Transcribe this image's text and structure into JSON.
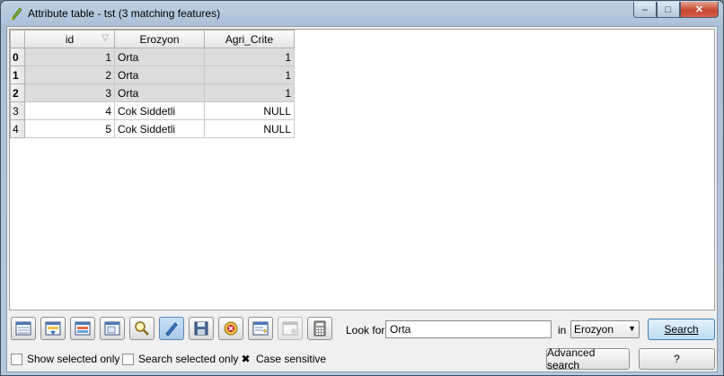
{
  "window": {
    "title": "Attribute table - tst (3 matching features)",
    "controls": {
      "minimize": "–",
      "maximize": "□",
      "close": "✕"
    }
  },
  "table": {
    "columns": [
      "id",
      "Erozyon",
      "Agri_Crite"
    ],
    "rows": [
      {
        "header": "0",
        "id": "1",
        "erozyon": "Orta",
        "agri": "1",
        "selected": true
      },
      {
        "header": "1",
        "id": "2",
        "erozyon": "Orta",
        "agri": "1",
        "selected": true
      },
      {
        "header": "2",
        "id": "3",
        "erozyon": "Orta",
        "agri": "1",
        "selected": true
      },
      {
        "header": "3",
        "id": "4",
        "erozyon": "Cok Siddetli",
        "agri": "NULL",
        "selected": false
      },
      {
        "header": "4",
        "id": "5",
        "erozyon": "Cok Siddetli",
        "agri": "NULL",
        "selected": false
      }
    ]
  },
  "toolbar": {
    "buttons": [
      "remove-selection-icon",
      "move-selection-to-top-icon",
      "invert-selection-icon",
      "copy-selected-rows-icon",
      "zoom-to-selection-icon",
      "toggle-editing-icon",
      "save-edits-icon",
      "delete-selected-icon",
      "new-column-icon",
      "delete-column-icon",
      "field-calculator-icon"
    ]
  },
  "search": {
    "look_for_label": "Look for",
    "value": "Orta",
    "in_label": "in",
    "field": "Erozyon",
    "search_button": "Search"
  },
  "options": {
    "show_selected_only": "Show selected only",
    "search_selected_only": "Search selected only",
    "case_sensitive": "Case sensitive"
  },
  "buttons": {
    "advanced_search": "Advanced search",
    "help": "?"
  }
}
